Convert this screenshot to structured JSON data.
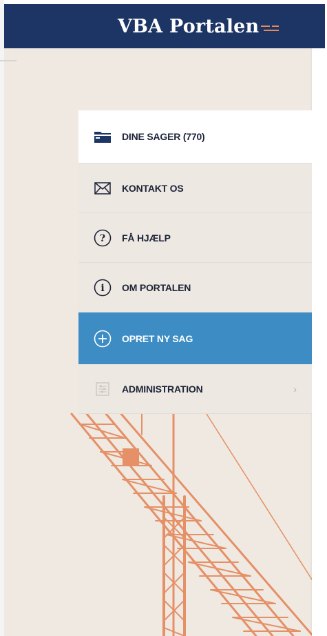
{
  "header": {
    "brand_text": "VBA Portalen",
    "brand_color": "#1c3564",
    "accent_color": "#e9895a"
  },
  "menu": {
    "items": [
      {
        "label": "DINE SAGER (770)",
        "icon": "folder-icon",
        "state": "active"
      },
      {
        "label": "KONTAKT OS",
        "icon": "envelope-icon",
        "state": "normal"
      },
      {
        "label": "FÅ HJÆLP",
        "icon": "question-circle-icon",
        "state": "normal"
      },
      {
        "label": "OM PORTALEN",
        "icon": "info-circle-icon",
        "state": "normal"
      },
      {
        "label": "OPRET NY SAG",
        "icon": "plus-circle-icon",
        "state": "primary"
      },
      {
        "label": "ADMINISTRATION",
        "icon": "settings-sliders-icon",
        "state": "normal",
        "has_submenu": true
      }
    ],
    "primary_color": "#3d8dc4"
  }
}
